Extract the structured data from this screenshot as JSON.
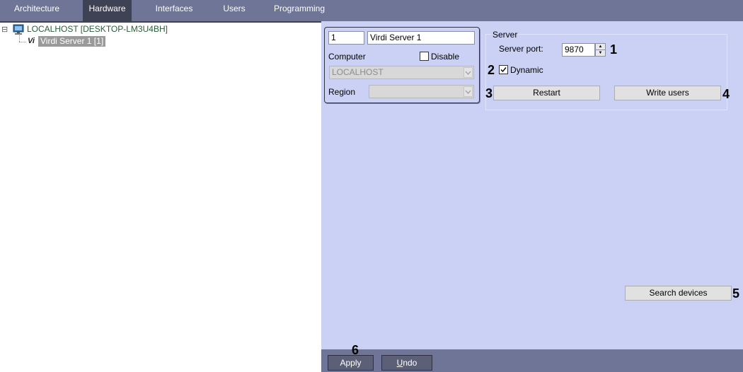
{
  "tabs": [
    {
      "label": "Architecture",
      "active": false
    },
    {
      "label": "Hardware",
      "active": true
    },
    {
      "label": "Interfaces",
      "active": false
    },
    {
      "label": "Users",
      "active": false
    },
    {
      "label": "Programming",
      "active": false
    }
  ],
  "tree": {
    "root": {
      "expander": "⊟",
      "icon": "computer-icon",
      "label": "LOCALHOST [DESKTOP-LM3U4BH]"
    },
    "child": {
      "icon_text": "Vi",
      "label": "Virdi Server 1 [1]"
    }
  },
  "object": {
    "id": "1",
    "name": "Virdi Server 1",
    "computer_label": "Computer",
    "disable_label": "Disable",
    "disable_checked": false,
    "computer_value": "LOCALHOST",
    "region_label": "Region",
    "region_value": ""
  },
  "server": {
    "group_title": "Server",
    "port_label": "Server port:",
    "port_value": "9870",
    "dynamic_label": "Dynamic",
    "dynamic_checked": true,
    "restart_label": "Restart",
    "write_users_label": "Write users",
    "search_label": "Search devices"
  },
  "callouts": {
    "c1": "1",
    "c2": "2",
    "c3": "3",
    "c4": "4",
    "c5": "5",
    "c6": "6"
  },
  "footer": {
    "apply_label": "Apply",
    "undo_label": "Undo"
  },
  "colors": {
    "tabbar": "#6f7596",
    "panel": "#cbd1f4",
    "active_tab": "#3f4255"
  }
}
